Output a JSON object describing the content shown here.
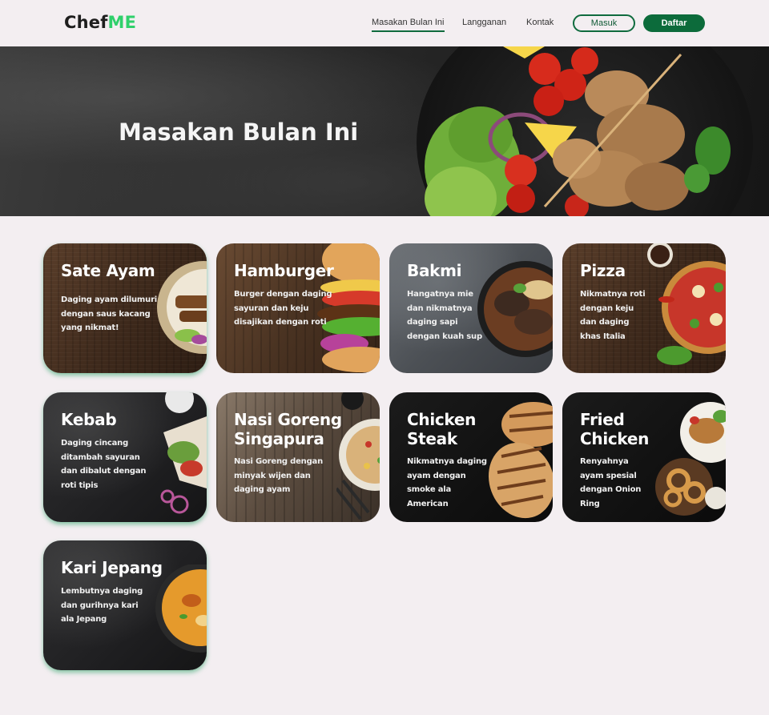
{
  "brand": {
    "part1": "Chef",
    "part2": "ME",
    "accent": "#2fd06b"
  },
  "nav": {
    "links": [
      "Masakan Bulan Ini",
      "Langganan",
      "Kontak"
    ],
    "login": "Masuk",
    "signup": "Daftar",
    "primary_color": "#0c6b3b"
  },
  "hero": {
    "title": "Masakan Bulan Ini"
  },
  "cards": [
    {
      "title": "Sate Ayam",
      "desc": "Daging ayam dilumuri dengan saus kacang yang nikmat!"
    },
    {
      "title": "Hamburger",
      "desc": "Burger dengan daging sayuran dan keju disajikan dengan roti"
    },
    {
      "title": "Bakmi",
      "desc": "Hangatnya mie dan nikmatnya daging sapi dengan kuah sup"
    },
    {
      "title": "Pizza",
      "desc": "Nikmatnya roti dengan keju dan daging khas Italia"
    },
    {
      "title": "Kebab",
      "desc": "Daging cincang ditambah sayuran dan dibalut dengan roti tipis"
    },
    {
      "title": "Nasi Goreng Singapura",
      "desc": "Nasi Goreng dengan minyak wijen dan daging ayam"
    },
    {
      "title": "Chicken Steak",
      "desc": "Nikmatnya daging ayam dengan smoke ala American"
    },
    {
      "title": "Fried Chicken",
      "desc": "Renyahnya ayam spesial dengan Onion Ring"
    },
    {
      "title": "Kari Jepang",
      "desc": "Lembutnya daging dan gurihnya kari ala Jepang"
    }
  ]
}
